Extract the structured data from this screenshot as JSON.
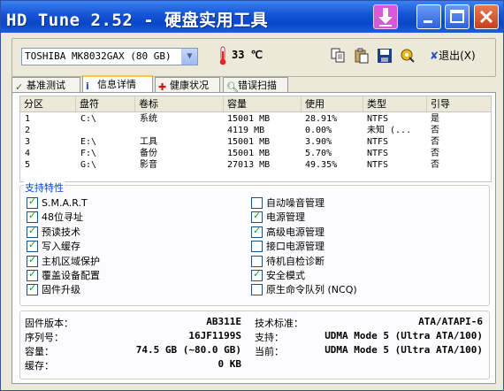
{
  "window": {
    "title": "HD Tune 2.52 - 硬盘实用工具"
  },
  "toolbar": {
    "drive_selected": "TOSHIBA MK8032GAX (80 GB)",
    "temperature": "33 ℃",
    "exit_label": "退出(X)"
  },
  "tabs": [
    {
      "label": "基准测试",
      "icon": "checkmark-icon"
    },
    {
      "label": "信息详情",
      "icon": "info-icon"
    },
    {
      "label": "健康状况",
      "icon": "plus-icon"
    },
    {
      "label": "错误扫描",
      "icon": "magnifier-icon"
    }
  ],
  "partitions": {
    "headers": [
      "分区",
      "盘符",
      "卷标",
      "容量",
      "使用",
      "类型",
      "引导"
    ],
    "rows": [
      [
        "1",
        "C:\\",
        "系统",
        "15001 MB",
        "28.91%",
        "NTFS",
        "是"
      ],
      [
        "2",
        "",
        "",
        "4119 MB",
        "0.00%",
        "未知 (...",
        "否"
      ],
      [
        "3",
        "E:\\",
        "工具",
        "15001 MB",
        "3.90%",
        "NTFS",
        "否"
      ],
      [
        "4",
        "F:\\",
        "备份",
        "15001 MB",
        "5.70%",
        "NTFS",
        "否"
      ],
      [
        "5",
        "G:\\",
        "影音",
        "27013 MB",
        "49.35%",
        "NTFS",
        "否"
      ]
    ]
  },
  "features": {
    "title": "支持特性",
    "left": [
      {
        "label": "S.M.A.R.T",
        "checked": true
      },
      {
        "label": "48位寻址",
        "checked": true
      },
      {
        "label": "预读技术",
        "checked": true
      },
      {
        "label": "写入缓存",
        "checked": true
      },
      {
        "label": "主机区域保护",
        "checked": true
      },
      {
        "label": "覆盖设备配置",
        "checked": true
      },
      {
        "label": "固件升级",
        "checked": true
      }
    ],
    "right": [
      {
        "label": "自动噪音管理",
        "checked": false
      },
      {
        "label": "电源管理",
        "checked": true
      },
      {
        "label": "高级电源管理",
        "checked": true
      },
      {
        "label": "接口电源管理",
        "checked": false
      },
      {
        "label": "待机自检诊断",
        "checked": false
      },
      {
        "label": "安全模式",
        "checked": true
      },
      {
        "label": "原生命令队列 (NCQ)",
        "checked": false
      }
    ]
  },
  "info": {
    "firmware_label": "固件版本：",
    "firmware": "AB311E",
    "serial_label": "序列号：",
    "serial": "16JF1199S",
    "capacity_label": "容量：",
    "capacity": "74.5 GB (~80.0 GB)",
    "cache_label": "缓存：",
    "cache": "0 KB",
    "standard_label": "技术标准：",
    "standard": "ATA/ATAPI-6",
    "support_label": "支持：",
    "support": "UDMA Mode 5 (Ultra ATA/100)",
    "current_label": "当前：",
    "current": "UDMA Mode 5 (Ultra ATA/100)"
  }
}
